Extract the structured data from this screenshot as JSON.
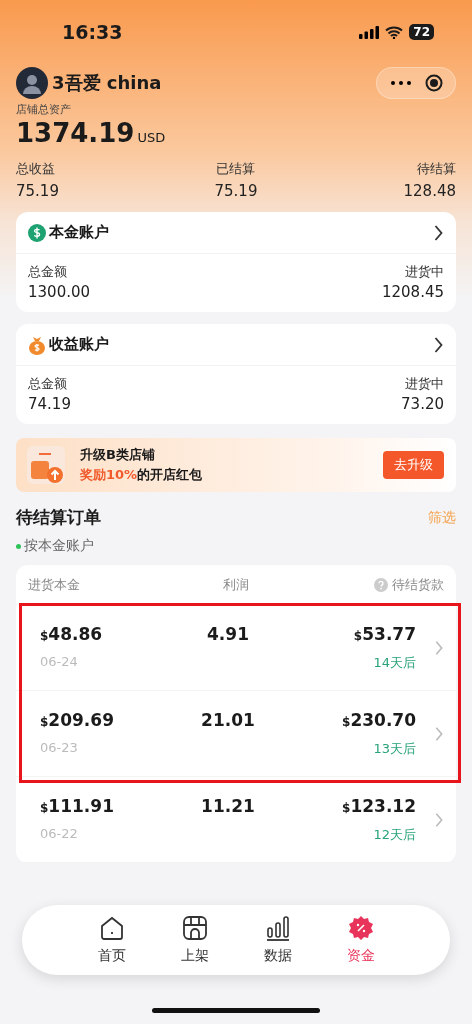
{
  "status_bar": {
    "time": "16:33",
    "battery": "72"
  },
  "profile": {
    "name": "3吾爱 china"
  },
  "balance": {
    "label": "店铺总资产",
    "amount": "1374.19",
    "currency": "USD"
  },
  "stats": [
    {
      "label": "总收益",
      "value": "75.19"
    },
    {
      "label": "已结算",
      "value": "75.19"
    },
    {
      "label": "待结算",
      "value": "128.48"
    }
  ],
  "accounts": [
    {
      "kind": "principal",
      "title": "本金账户",
      "left_label": "总金额",
      "left_value": "1300.00",
      "right_label": "进货中",
      "right_value": "1208.45"
    },
    {
      "kind": "earnings",
      "title": "收益账户",
      "left_label": "总金额",
      "left_value": "74.19",
      "right_label": "进货中",
      "right_value": "73.20"
    }
  ],
  "banner": {
    "title": "升级B类店铺",
    "subtitle_highlight": "奖励10%",
    "subtitle_rest": "的开店红包",
    "button": "去升级"
  },
  "orders": {
    "title": "待结算订单",
    "filter": "筛选",
    "account_filter": "按本金账户",
    "columns": [
      "进货本金",
      "利润",
      "待结货款"
    ],
    "rows": [
      {
        "cost": "$48.86",
        "profit": "4.91",
        "payout": "$53.77",
        "date": "06-24",
        "due": "14天后",
        "highlighted": true
      },
      {
        "cost": "$209.69",
        "profit": "21.01",
        "payout": "$230.70",
        "date": "06-23",
        "due": "13天后",
        "highlighted": true
      },
      {
        "cost": "$111.91",
        "profit": "11.21",
        "payout": "$123.12",
        "date": "06-22",
        "due": "12天后",
        "highlighted": false
      }
    ]
  },
  "nav": [
    {
      "kind": "home",
      "label": "首页",
      "selected": false
    },
    {
      "kind": "shop",
      "label": "上架",
      "selected": false
    },
    {
      "kind": "data",
      "label": "数据",
      "selected": false
    },
    {
      "kind": "funds",
      "label": "资金",
      "selected": true
    }
  ]
}
